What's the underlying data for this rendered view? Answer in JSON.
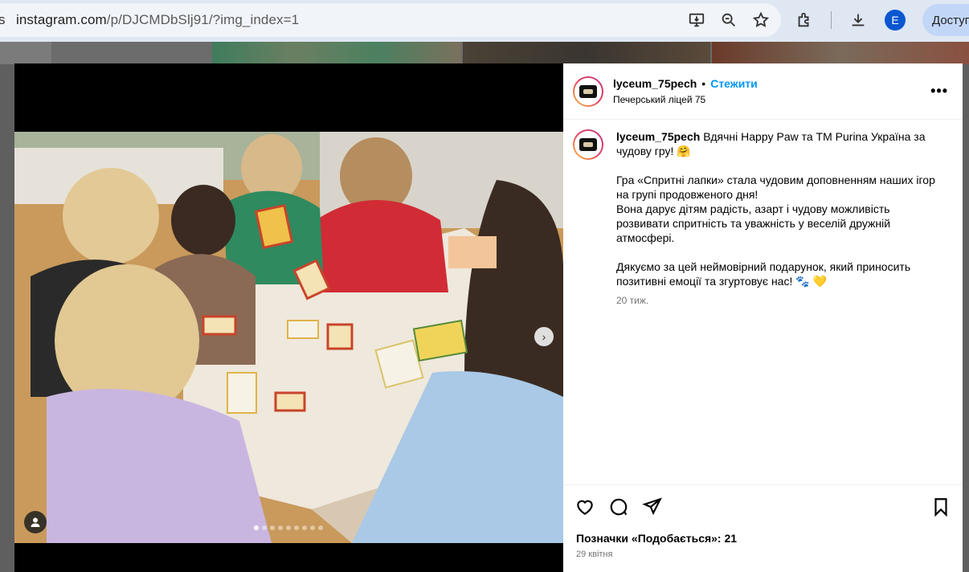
{
  "browser": {
    "url_host": "instagram.com",
    "url_path": "/p/DJCMDbSlj91/?img_index=1",
    "profile_initial": "E",
    "access_button_label": "Доступ",
    "omnibox_left_glyph": "s"
  },
  "post": {
    "username": "lyceum_75pech",
    "separator": "•",
    "follow_label": "Стежити",
    "location": "Печерський ліцей 75",
    "more_label": "•••",
    "caption": {
      "username": "lyceum_75pech",
      "line1": "Вдячні Happy Paw та ТМ Purina Україна за чудову гру! 🤗",
      "paragraph2": "Гра «Спритні лапки» стала чудовим доповненням наших ігор на групі продовженого дня!\nВона дарує дітям радість, азарт і чудову можливість розвивати спритність та уважність у веселій дружній атмосфері.",
      "paragraph3": "Дякуємо за цей неймовірний подарунок, який приносить позитивні емоції та згуртовує нас! 🐾 💛",
      "time_ago": "20 тиж."
    },
    "likes_text": "Позначки «Подобається»: 21",
    "date_text": "29 квітня",
    "carousel": {
      "total": 9,
      "active_index": 1
    },
    "next_arrow": "›"
  },
  "icons": [
    "screen-cast-icon",
    "zoom-icon",
    "star-icon",
    "extensions-icon",
    "download-icon",
    "heart-icon",
    "comment-icon",
    "share-icon",
    "bookmark-icon",
    "user-tag-icon"
  ]
}
